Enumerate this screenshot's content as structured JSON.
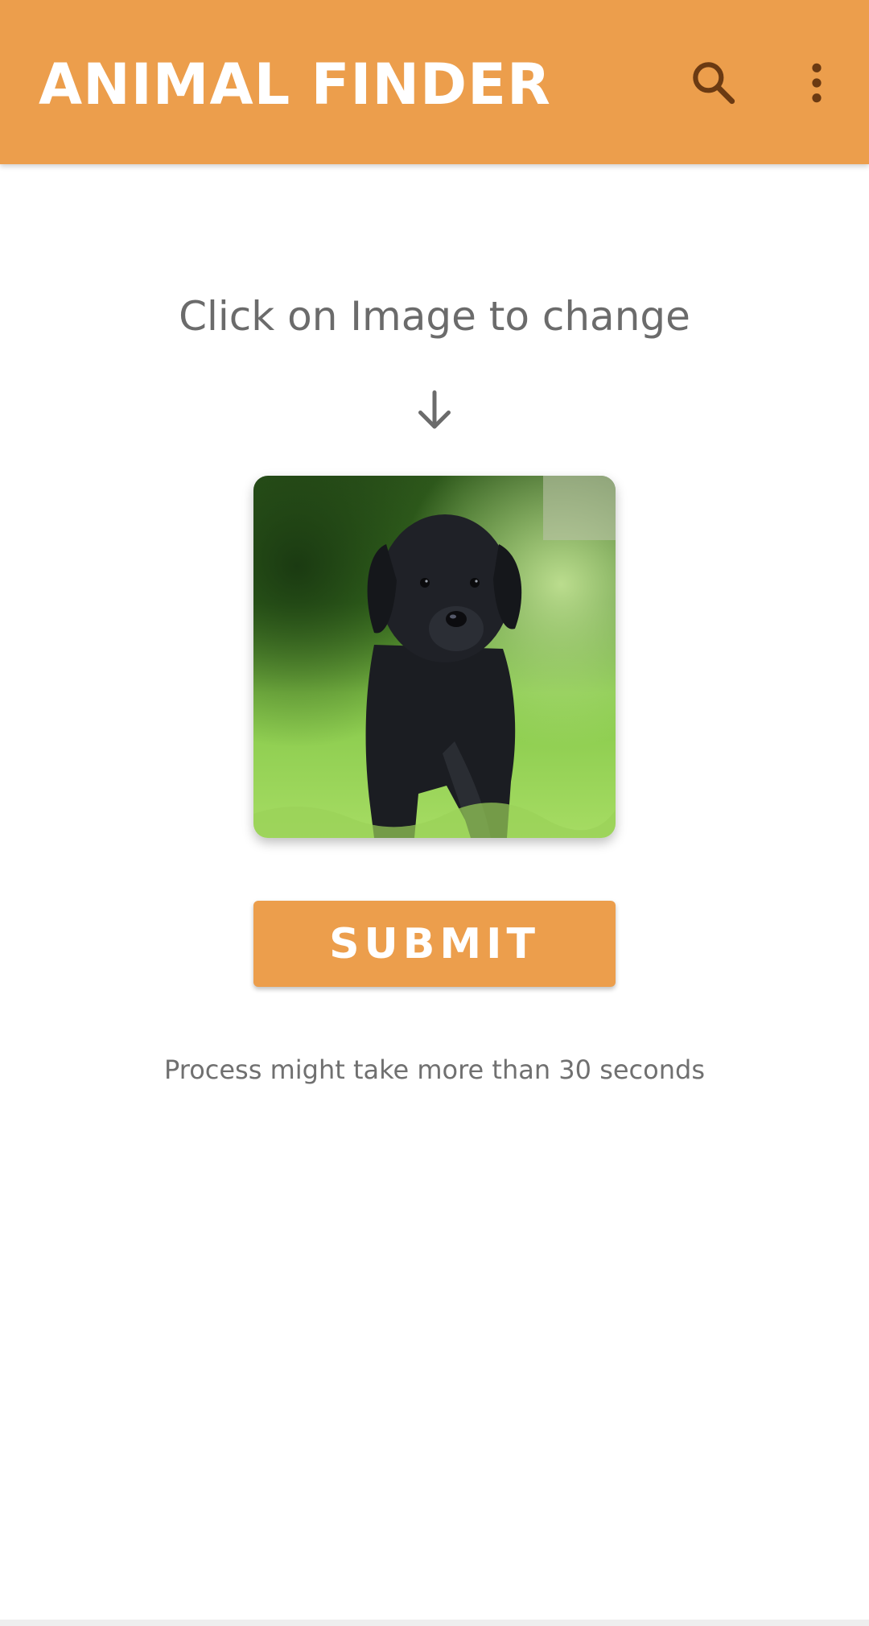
{
  "toolbar": {
    "title": "ANIMAL FINDER",
    "background_color": "#EC9E4C",
    "title_color": "#FFFFFF",
    "icon_color": "#6B3A12",
    "actions": [
      {
        "icon": "search-icon"
      },
      {
        "icon": "more-vert-icon"
      }
    ]
  },
  "main": {
    "hint": "Click on Image to change",
    "hint_icon": "arrow-down-icon",
    "image": {
      "subject": "black puppy on grass"
    },
    "submit_label": "SUBMIT",
    "note": "Process might take more than 30 seconds"
  }
}
